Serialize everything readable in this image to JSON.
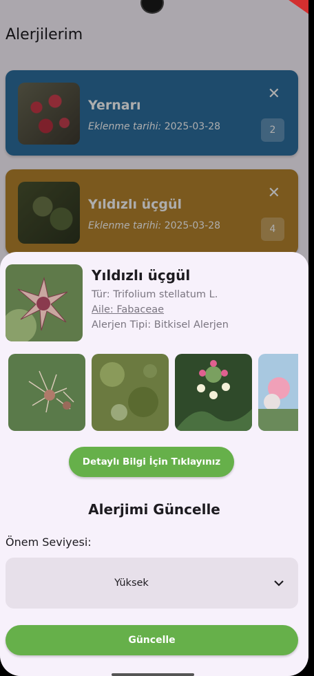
{
  "page": {
    "title": "Alerjilerim"
  },
  "cards": [
    {
      "name": "Yernarı",
      "date_label": "Eklenme tarihi:",
      "date": "2025-03-28",
      "badge": "2",
      "color": "#2d6fa0"
    },
    {
      "name": "Yıldızlı üçgül",
      "date_label": "Eklenme tarihi:",
      "date": "2025-03-28",
      "badge": "4",
      "color": "#b5832d"
    }
  ],
  "sheet": {
    "name": "Yıldızlı üçgül",
    "species": "Tür: Trifolium stellatum L.",
    "family": "Aile: Fabaceae",
    "allergen_type": "Alerjen Tipi: Bitkisel Alerjen",
    "detail_button": "Detaylı Bilgi İçin Tıklayınız",
    "section_title": "Alerjimi Güncelle",
    "severity_label": "Önem Seviyesi:",
    "severity_value": "Yüksek",
    "update_button": "Güncelle"
  },
  "icons": {
    "close": "close-icon",
    "chevron": "chevron-down-icon"
  },
  "colors": {
    "accent": "#66b04a",
    "card_blue": "#2d6fa0",
    "card_gold": "#b5832d"
  }
}
